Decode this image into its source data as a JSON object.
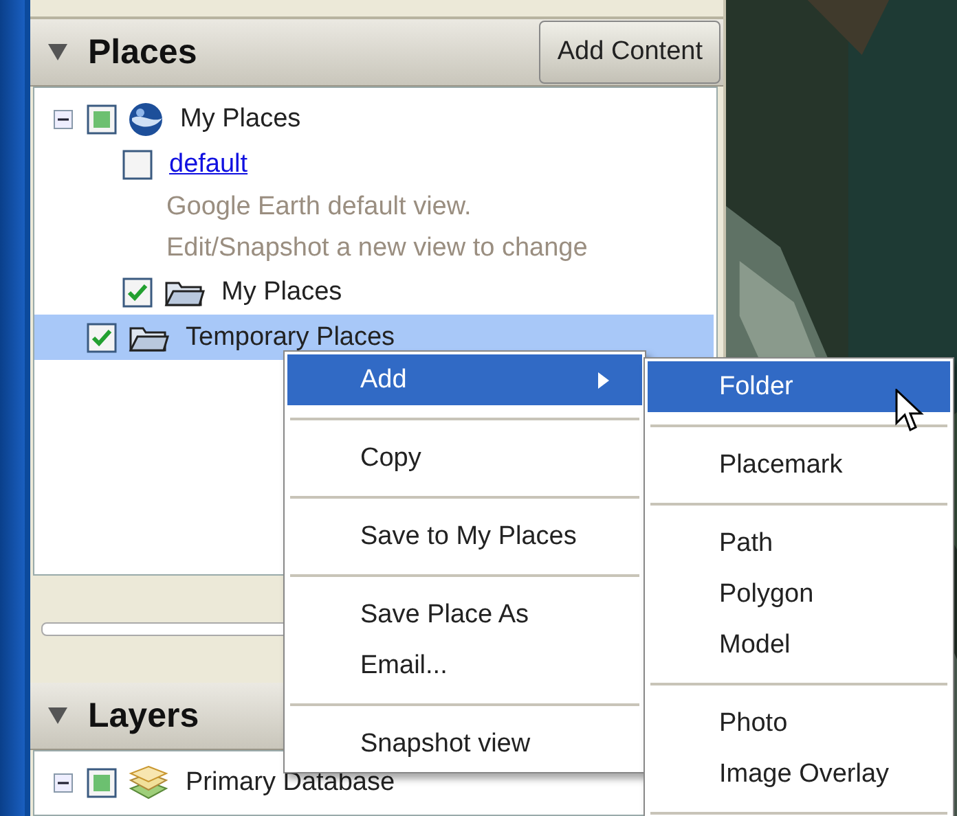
{
  "places": {
    "title": "Places",
    "expanded": true,
    "button": "Add Content",
    "tree": [
      {
        "label": "My Places",
        "kind": "root",
        "checked": false,
        "partial": true,
        "expanded": true,
        "selected": false,
        "children": [
          {
            "label": "default",
            "kind": "view",
            "checked": false,
            "partial": false,
            "selected": false,
            "description": [
              "Google Earth default view.",
              "Edit/Snapshot a new view to change"
            ]
          },
          {
            "label": "My Places",
            "kind": "folder",
            "checked": true,
            "partial": false,
            "selected": false
          }
        ]
      },
      {
        "label": "Temporary Places",
        "kind": "folder",
        "checked": true,
        "partial": false,
        "selected": true
      }
    ]
  },
  "layers": {
    "title": "Layers",
    "expanded": true,
    "tree": [
      {
        "label": "Primary Database",
        "kind": "database",
        "checked": false,
        "partial": true,
        "expanded": true,
        "selected": false
      }
    ]
  },
  "context_menu": {
    "groups": [
      [
        {
          "label": "Add",
          "selected": true,
          "submenu": true
        }
      ],
      [
        {
          "label": "Copy",
          "selected": false,
          "submenu": false
        }
      ],
      [
        {
          "label": "Save to My Places",
          "selected": false,
          "submenu": false
        }
      ],
      [
        {
          "label": "Save Place As",
          "selected": false,
          "submenu": false
        },
        {
          "label": "Email...",
          "selected": false,
          "submenu": false
        }
      ],
      [
        {
          "label": "Snapshot view",
          "selected": false,
          "submenu": false
        }
      ]
    ]
  },
  "submenu": {
    "groups": [
      [
        {
          "label": "Folder",
          "selected": true
        }
      ],
      [
        {
          "label": "Placemark",
          "selected": false
        }
      ],
      [
        {
          "label": "Path",
          "selected": false
        },
        {
          "label": "Polygon",
          "selected": false
        },
        {
          "label": "Model",
          "selected": false
        }
      ],
      [
        {
          "label": "Photo",
          "selected": false
        },
        {
          "label": "Image Overlay",
          "selected": false
        }
      ]
    ]
  }
}
